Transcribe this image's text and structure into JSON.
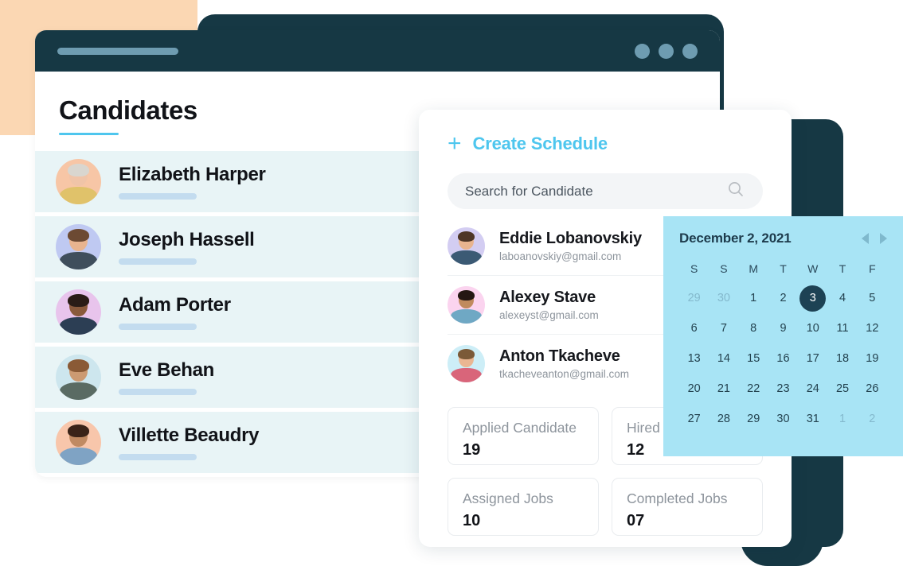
{
  "window": {
    "titlebar": {
      "placeholder_bar": "",
      "dots": [
        "dot-1",
        "dot-2",
        "dot-3"
      ]
    },
    "page_title": "Candidates"
  },
  "candidates": [
    {
      "name": "Elizabeth Harper",
      "avatar_bg": "#f7c6a6",
      "skin": "#f0c4a8",
      "hair": "#d9d6cf",
      "shirt": "#e0c26a"
    },
    {
      "name": "Joseph Hassell",
      "avatar_bg": "#bfc9f2",
      "skin": "#e8b48f",
      "hair": "#6c4a33",
      "shirt": "#3f4e5c"
    },
    {
      "name": "Adam Porter",
      "avatar_bg": "#e8c4ec",
      "skin": "#8a5a3c",
      "hair": "#2a1c16",
      "shirt": "#2c3e54"
    },
    {
      "name": "Eve Behan",
      "avatar_bg": "#cde6ee",
      "skin": "#cc9a72",
      "hair": "#8a5a36",
      "shirt": "#5a6b63"
    },
    {
      "name": "Villette Beaudry",
      "avatar_bg": "#f8c6ab",
      "skin": "#c08a62",
      "hair": "#3a2318",
      "shirt": "#7fa3c4"
    }
  ],
  "schedule": {
    "create_label": "Create Schedule",
    "plus_icon": "plus-icon",
    "search": {
      "placeholder": "Search for Candidate",
      "value": "",
      "icon": "search-icon"
    },
    "people": [
      {
        "name": "Eddie Lobanovskiy",
        "email": "laboanovskiy@gmail.com",
        "avatar_bg": "#d3cdf2",
        "skin": "#e8b48f",
        "hair": "#4e3626",
        "shirt": "#3b5a74"
      },
      {
        "name": "Alexey Stave",
        "email": "alexeyst@gmail.com",
        "avatar_bg": "#fbd4ef",
        "skin": "#c08a5e",
        "hair": "#241713",
        "shirt": "#6fa8c4"
      },
      {
        "name": "Anton Tkacheve",
        "email": "tkacheveanton@gmail.com",
        "avatar_bg": "#cdeef7",
        "skin": "#eab692",
        "hair": "#7b5a38",
        "shirt": "#d9657a"
      }
    ],
    "stats": [
      {
        "label": "Applied Candidate",
        "value": "19"
      },
      {
        "label": "Hired",
        "value": "12"
      },
      {
        "label": "Assigned Jobs",
        "value": "10"
      },
      {
        "label": "Completed Jobs",
        "value": "07"
      }
    ]
  },
  "calendar": {
    "title": "December 2, 2021",
    "prev_icon": "chevron-left-icon",
    "next_icon": "chevron-right-icon",
    "weekdays": [
      "S",
      "S",
      "M",
      "T",
      "W",
      "T",
      "F"
    ],
    "selected_day": 3,
    "weeks": [
      [
        {
          "d": "29",
          "m": true
        },
        {
          "d": "30",
          "m": true
        },
        {
          "d": "1"
        },
        {
          "d": "2"
        },
        {
          "d": "3",
          "sel": true
        },
        {
          "d": "4"
        },
        {
          "d": "5"
        }
      ],
      [
        {
          "d": "6"
        },
        {
          "d": "7"
        },
        {
          "d": "8"
        },
        {
          "d": "9"
        },
        {
          "d": "10"
        },
        {
          "d": "11"
        },
        {
          "d": "12"
        }
      ],
      [
        {
          "d": "13"
        },
        {
          "d": "14"
        },
        {
          "d": "15"
        },
        {
          "d": "16"
        },
        {
          "d": "17"
        },
        {
          "d": "18"
        },
        {
          "d": "19"
        }
      ],
      [
        {
          "d": "20"
        },
        {
          "d": "21"
        },
        {
          "d": "22"
        },
        {
          "d": "23"
        },
        {
          "d": "24"
        },
        {
          "d": "25"
        },
        {
          "d": "26"
        }
      ],
      [
        {
          "d": "27"
        },
        {
          "d": "28"
        },
        {
          "d": "29"
        },
        {
          "d": "30"
        },
        {
          "d": "31"
        },
        {
          "d": "1",
          "m": true
        },
        {
          "d": "2",
          "m": true
        }
      ]
    ]
  },
  "colors": {
    "navy": "#163844",
    "accent_cyan": "#4ec6ee",
    "calendar_bg": "#a8e4f5",
    "row_bg": "#e8f4f6",
    "peach_deco": "#fbd7b3"
  }
}
